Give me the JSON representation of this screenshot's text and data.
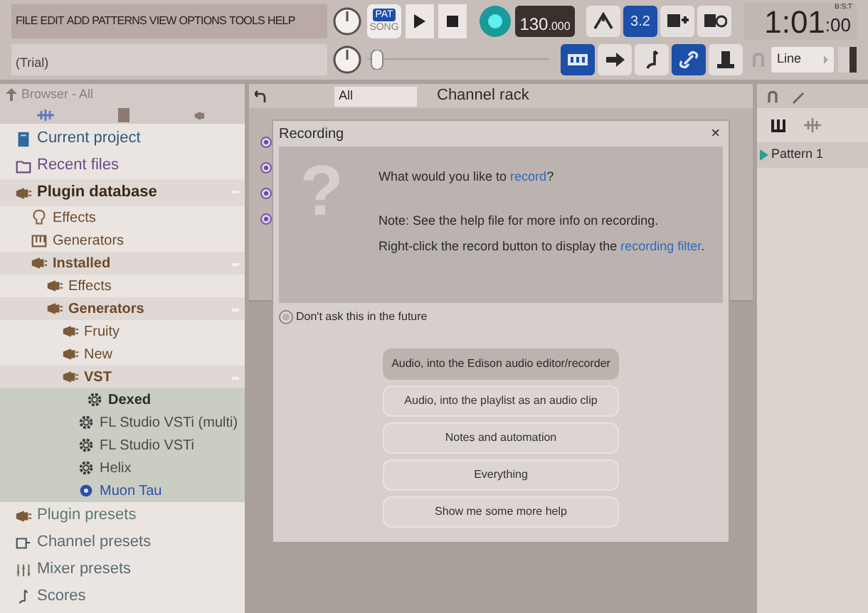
{
  "menu": [
    "FILE",
    "EDIT",
    "ADD",
    "PATTERNS",
    "VIEW",
    "OPTIONS",
    "TOOLS",
    "HELP"
  ],
  "transport": {
    "pat": "PAT",
    "song": "SONG",
    "mode_pat": true,
    "tempo": "130",
    "tempo_fraction": ".000",
    "counter_icon": "3.2",
    "time": "1:01",
    ":00": ":00",
    "time_unit": "B:S:T",
    "hint": "(Trial)",
    "snap": "Line",
    "master": {
      "level": 0.02
    }
  },
  "toolbar_buttons": [
    {
      "kind": "metronome",
      "on": false
    },
    {
      "kind": "counter",
      "on": true
    },
    {
      "kind": "keys-plus",
      "on": false
    },
    {
      "kind": "keys-loop",
      "on": false
    }
  ],
  "toolbar_buttons_2": [
    {
      "kind": "typing",
      "on": true
    },
    {
      "kind": "arrow",
      "on": false
    },
    {
      "kind": "note",
      "on": false
    },
    {
      "kind": "link",
      "on": true
    },
    {
      "kind": "hat",
      "on": false
    }
  ],
  "browser": {
    "title": "Browser - All",
    "tree": [
      {
        "label": "Current project",
        "kind": "file",
        "color": "#2f5a7a",
        "expanded": false
      },
      {
        "label": "Recent files",
        "kind": "folder",
        "color": "#6a4a86",
        "expanded": false
      },
      {
        "label": "Plugin database",
        "kind": "plug",
        "color": "#3a2a1a",
        "expanded": true,
        "children": [
          {
            "label": "Effects",
            "kind": "bulb",
            "expanded": false
          },
          {
            "label": "Generators",
            "kind": "keys",
            "expanded": false
          },
          {
            "label": "Installed",
            "kind": "plug",
            "expanded": true,
            "children": [
              {
                "label": "Effects",
                "kind": "plug",
                "expanded": false
              },
              {
                "label": "Generators",
                "kind": "plug",
                "expanded": true,
                "children": [
                  {
                    "label": "Fruity",
                    "kind": "plug",
                    "expanded": false
                  },
                  {
                    "label": "New",
                    "kind": "plug",
                    "expanded": false
                  },
                  {
                    "label": "VST",
                    "kind": "plug",
                    "expanded": true,
                    "children": [
                      {
                        "label": "Dexed",
                        "kind": "gear",
                        "selected": true,
                        "color": "#2a2a2a"
                      },
                      {
                        "label": "FL Studio VSTi (multi)",
                        "kind": "gear",
                        "selected": false,
                        "color": "#4a4a4a"
                      },
                      {
                        "label": "FL Studio VSTi",
                        "kind": "gear",
                        "selected": false,
                        "color": "#4a4a4a"
                      },
                      {
                        "label": "Helix",
                        "kind": "gear",
                        "selected": false,
                        "color": "#4a4a4a"
                      },
                      {
                        "label": "Muon Tau",
                        "kind": "gear-filled",
                        "selected": false,
                        "color": "#2e4fa8"
                      }
                    ]
                  }
                ]
              }
            ]
          }
        ]
      },
      {
        "label": "Plugin presets",
        "kind": "plug",
        "color": "#5a7a68",
        "expanded": false
      },
      {
        "label": "Channel presets",
        "kind": "channel",
        "color": "#5a6a72",
        "expanded": false
      },
      {
        "label": "Mixer presets",
        "kind": "mixer",
        "color": "#5a6a72",
        "expanded": false
      },
      {
        "label": "Scores",
        "kind": "note",
        "color": "#5a6a72",
        "expanded": false
      }
    ]
  },
  "channel_rack": {
    "filter": "All",
    "title": "Channel rack"
  },
  "dialog": {
    "title": "Recording",
    "close": "×",
    "icon": "?",
    "lines": [
      [
        {
          "text": "What would you like to ",
          "kind": "text"
        },
        {
          "text": "record",
          "kind": "link"
        },
        {
          "text": "?",
          "kind": "text"
        }
      ],
      [
        {
          "text": "Note: See the help file for more info on recording.",
          "kind": "text"
        }
      ],
      [
        {
          "text": "Right-click the record button to display the ",
          "kind": "text"
        },
        {
          "text": "recording filter",
          "kind": "link"
        },
        {
          "text": ".",
          "kind": "text"
        }
      ]
    ],
    "checkbox": {
      "label": "Don't ask this in the future",
      "checked": false
    },
    "options": [
      {
        "label": "Audio, into the Edison audio editor/recorder",
        "selected": true
      },
      {
        "label": "Audio, into the playlist as an audio clip",
        "selected": false
      },
      {
        "label": "Notes and automation",
        "selected": false
      },
      {
        "label": "Everything",
        "selected": false
      },
      {
        "label": "Show me some more help",
        "selected": false
      }
    ]
  },
  "playlist": {
    "patterns": [
      {
        "label": "Pattern 1",
        "selected": true
      }
    ]
  }
}
